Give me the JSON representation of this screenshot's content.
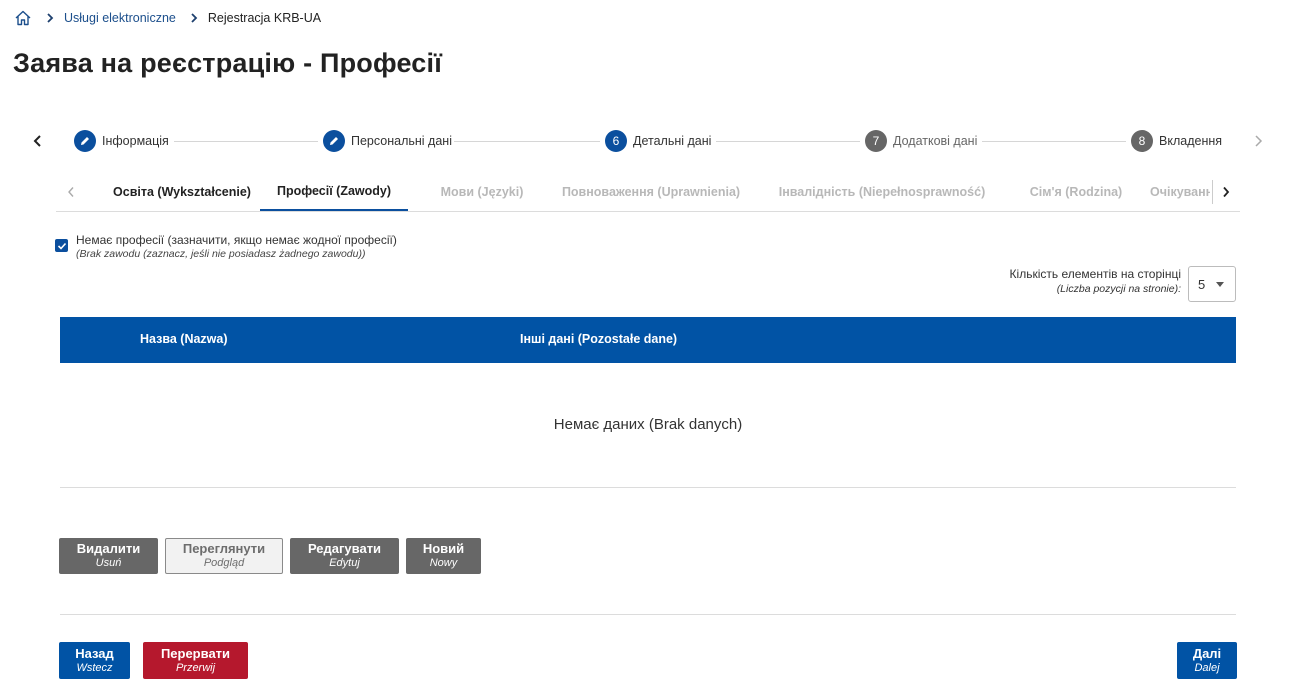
{
  "breadcrumb": {
    "home_icon": "home-icon",
    "items": [
      "Usługi elektroniczne",
      "Rejestracja KRB-UA"
    ]
  },
  "page_title": "Заява на реєстрацію - Професії",
  "stepper": {
    "steps": [
      {
        "marker": "edit-icon",
        "number": "",
        "label": "Інформація",
        "state": "done"
      },
      {
        "marker": "edit-icon",
        "number": "",
        "label": "Персональні дані",
        "state": "done"
      },
      {
        "marker": "",
        "number": "6",
        "label": "Детальні дані",
        "state": "current"
      },
      {
        "marker": "",
        "number": "7",
        "label": "Додаткові дані",
        "state": "upcoming"
      },
      {
        "marker": "",
        "number": "8",
        "label": "Вкладення",
        "state": "upcoming"
      }
    ]
  },
  "tabs": [
    {
      "label": "Освіта (Wykształcenie)",
      "state": "done"
    },
    {
      "label": "Професії (Zawody)",
      "state": "active"
    },
    {
      "label": "Мови (Języki)",
      "state": "disabled"
    },
    {
      "label": "Повноваження (Uprawnienia)",
      "state": "disabled"
    },
    {
      "label": "Інвалідність (Niepełnosprawność)",
      "state": "disabled"
    },
    {
      "label": "Сім'я (Rodzina)",
      "state": "disabled"
    },
    {
      "label": "Очікування",
      "state": "disabled"
    }
  ],
  "no_profession": {
    "checked": true,
    "label": "Немає професії (зазначити, якщо немає жодної професії)",
    "sublabel": "(Brak zawodu (zaznacz, jeśli nie posiadasz żadnego zawodu))"
  },
  "page_size": {
    "label": "Кількість елементів на сторінці",
    "sublabel": "(Liczba pozycji na stronie):",
    "value": "5"
  },
  "table": {
    "columns": [
      "Назва (Nazwa)",
      "Інші дані (Pozostałe dane)"
    ],
    "empty_message": "Немає даних (Brak danych)"
  },
  "actions": {
    "delete": {
      "label": "Видалити",
      "sub": "Usuń"
    },
    "view": {
      "label": "Переглянути",
      "sub": "Podgląd"
    },
    "edit": {
      "label": "Редагувати",
      "sub": "Edytuj"
    },
    "new": {
      "label": "Новий",
      "sub": "Nowy"
    }
  },
  "nav": {
    "back": {
      "label": "Назад",
      "sub": "Wstecz"
    },
    "cancel": {
      "label": "Перервати",
      "sub": "Przerwij"
    },
    "next": {
      "label": "Далі",
      "sub": "Dalej"
    }
  },
  "colors": {
    "primary": "#0153a5",
    "danger": "#b5182d",
    "secondary": "#676767"
  }
}
